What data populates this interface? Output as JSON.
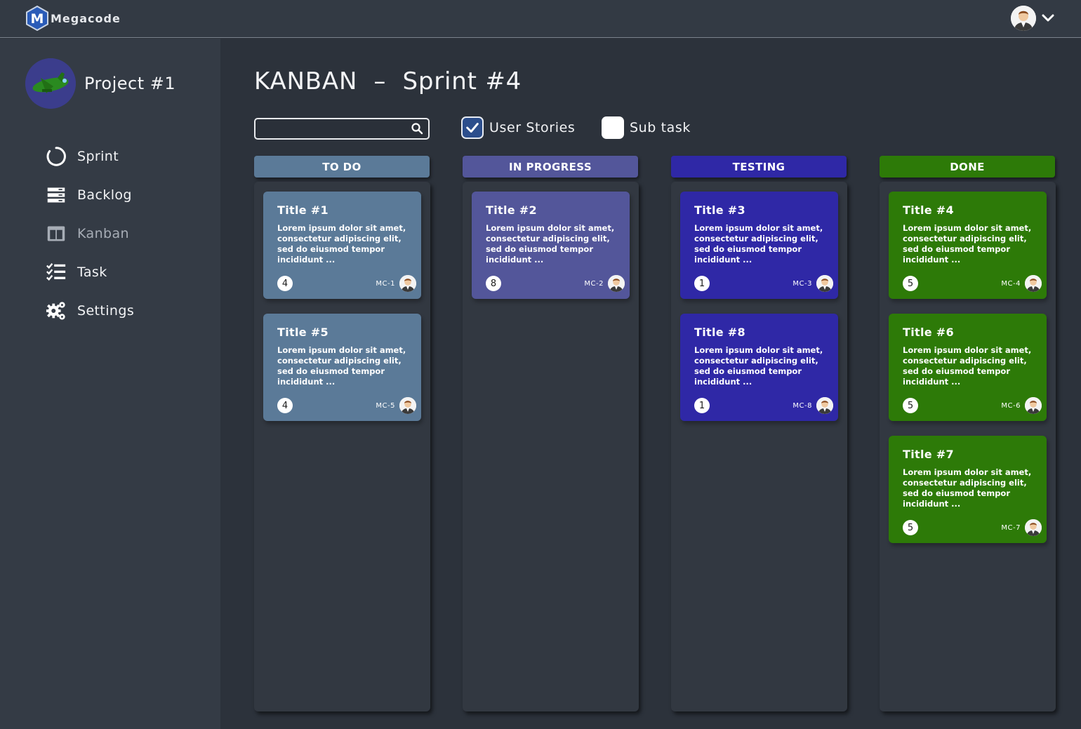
{
  "app": {
    "name": "Megacode",
    "logo_letter": "M"
  },
  "user_menu": {
    "avatar": "user-avatar-icon",
    "toggle_icon": "chevron-down-icon"
  },
  "project": {
    "name": "Project #1",
    "avatar": "airplane-avatar-icon"
  },
  "nav": {
    "items": [
      {
        "label": "Sprint",
        "icon": "sprint-circle-icon",
        "active": false
      },
      {
        "label": "Backlog",
        "icon": "backlog-list-icon",
        "active": false
      },
      {
        "label": "Kanban",
        "icon": "kanban-board-icon",
        "active": true
      },
      {
        "label": "Task",
        "icon": "task-checklist-icon",
        "active": false
      },
      {
        "label": "Settings",
        "icon": "settings-gears-icon",
        "active": false
      }
    ]
  },
  "page": {
    "title": "KANBAN  –  Sprint #4"
  },
  "search": {
    "value": "",
    "placeholder": ""
  },
  "filters": {
    "user_stories": {
      "label": "User Stories",
      "checked": true
    },
    "sub_task": {
      "label": "Sub task",
      "checked": false
    }
  },
  "columns": [
    {
      "title": "TO DO",
      "header_color": "#5b7a98",
      "header_text_color": "#ffffff",
      "card_color": "#5b7a98",
      "cards": [
        {
          "title": "Title #1",
          "description": "Lorem ipsum dolor sit amet, consectetur adipiscing elit, sed do eiusmod tempor incididunt ...",
          "points": "4",
          "key": "MC-1"
        },
        {
          "title": "Title #5",
          "description": "Lorem ipsum dolor sit amet, consectetur adipiscing elit, sed do eiusmod tempor incididunt ...",
          "points": "4",
          "key": "MC-5"
        }
      ]
    },
    {
      "title": "IN PROGRESS",
      "header_color": "#53569a",
      "header_text_color": "#ffffff",
      "card_color": "#53569a",
      "cards": [
        {
          "title": "Title #2",
          "description": "Lorem ipsum dolor sit amet, consectetur adipiscing elit, sed do eiusmod tempor incididunt ...",
          "points": "8",
          "key": "MC-2"
        }
      ]
    },
    {
      "title": "TESTING",
      "header_color": "#2f28a6",
      "header_text_color": "#ffffff",
      "card_color": "#2f28a6",
      "cards": [
        {
          "title": "Title #3",
          "description": "Lorem ipsum dolor sit amet, consectetur adipiscing elit, sed do eiusmod tempor incididunt ...",
          "points": "1",
          "key": "MC-3"
        },
        {
          "title": "Title #8",
          "description": "Lorem ipsum dolor sit amet, consectetur adipiscing elit, sed do eiusmod tempor incididunt ...",
          "points": "1",
          "key": "MC-8"
        }
      ]
    },
    {
      "title": "DONE",
      "header_color": "#2d7a08",
      "header_text_color": "#ffffff",
      "card_color": "#2d7a08",
      "cards": [
        {
          "title": "Title #4",
          "description": "Lorem ipsum dolor sit amet, consectetur adipiscing elit, sed do eiusmod tempor incididunt ...",
          "points": "5",
          "key": "MC-4"
        },
        {
          "title": "Title #6",
          "description": "Lorem ipsum dolor sit amet, consectetur adipiscing elit, sed do eiusmod tempor incididunt ...",
          "points": "5",
          "key": "MC-6"
        },
        {
          "title": "Title #7",
          "description": "Lorem ipsum dolor sit amet, consectetur adipiscing elit, sed do eiusmod tempor incididunt ...",
          "points": "5",
          "key": "MC-7"
        }
      ]
    }
  ]
}
